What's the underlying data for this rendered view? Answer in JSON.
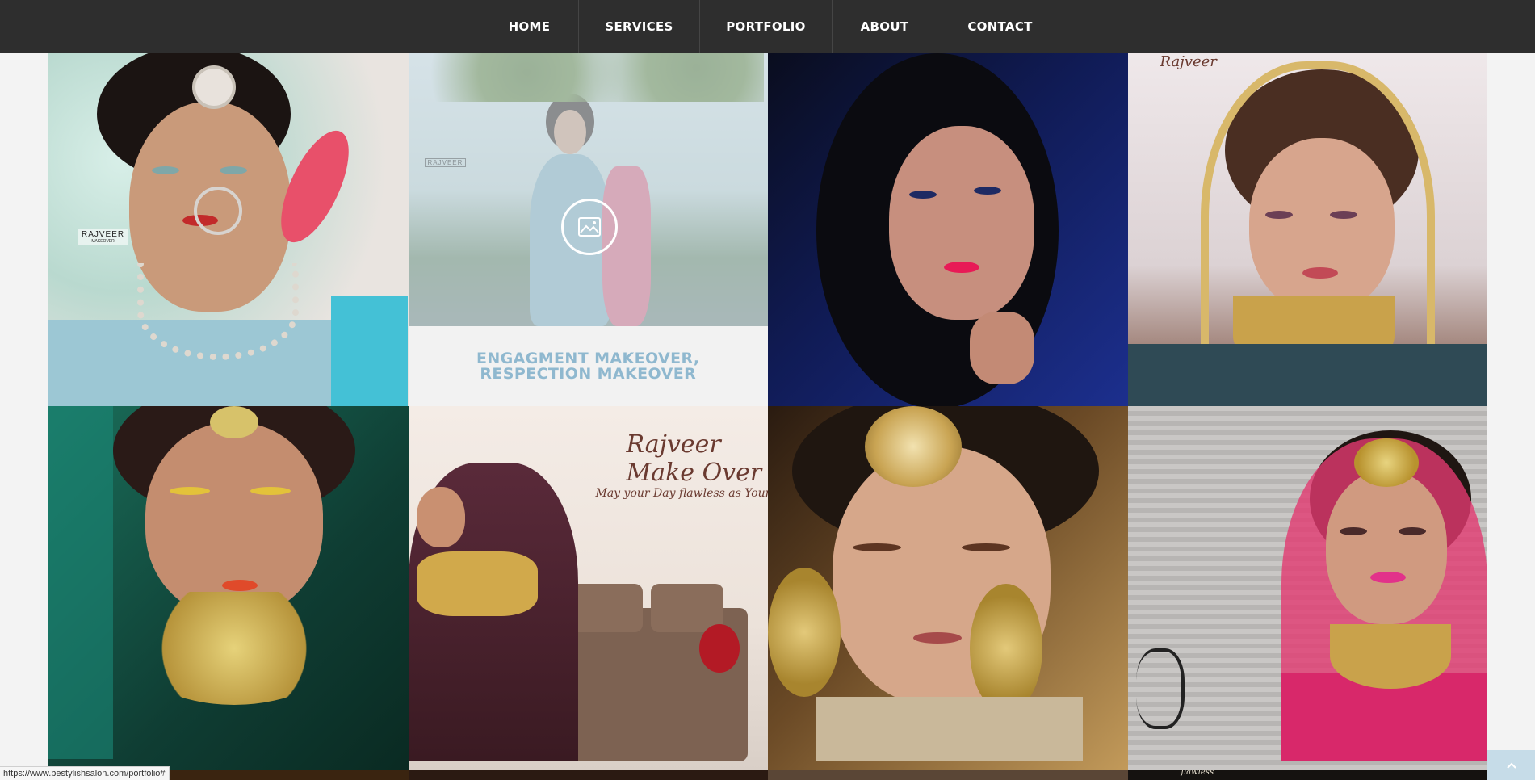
{
  "nav": {
    "items": [
      {
        "label": "HOME"
      },
      {
        "label": "SERVICES"
      },
      {
        "label": "PORTFOLIO"
      },
      {
        "label": "ABOUT"
      },
      {
        "label": "CONTACT"
      }
    ]
  },
  "portfolio": {
    "hover_caption": "ENGAGMENT MAKEOVER, RESPECTION MAKEOVER",
    "watermarks": {
      "rajveer_small": "RAJVEER",
      "rajveer_sub": "MAKEOVER",
      "rajveer_script_1": "Rajveer",
      "rajveer_script_2": "Make Over",
      "rajveer_tagline": "May your Day flawless as Your Makeup",
      "flawless": "flawless"
    }
  },
  "status_bar": {
    "url": "https://www.bestylishsalon.com/portfolio#"
  },
  "icons": {
    "gallery": "image-gallery-icon",
    "scroll_top": "chevron-up-icon"
  },
  "colors": {
    "nav_bg": "#2e2e2e",
    "caption_text": "#8fb8cf",
    "scroll_top_bg": "#c6dce8"
  }
}
